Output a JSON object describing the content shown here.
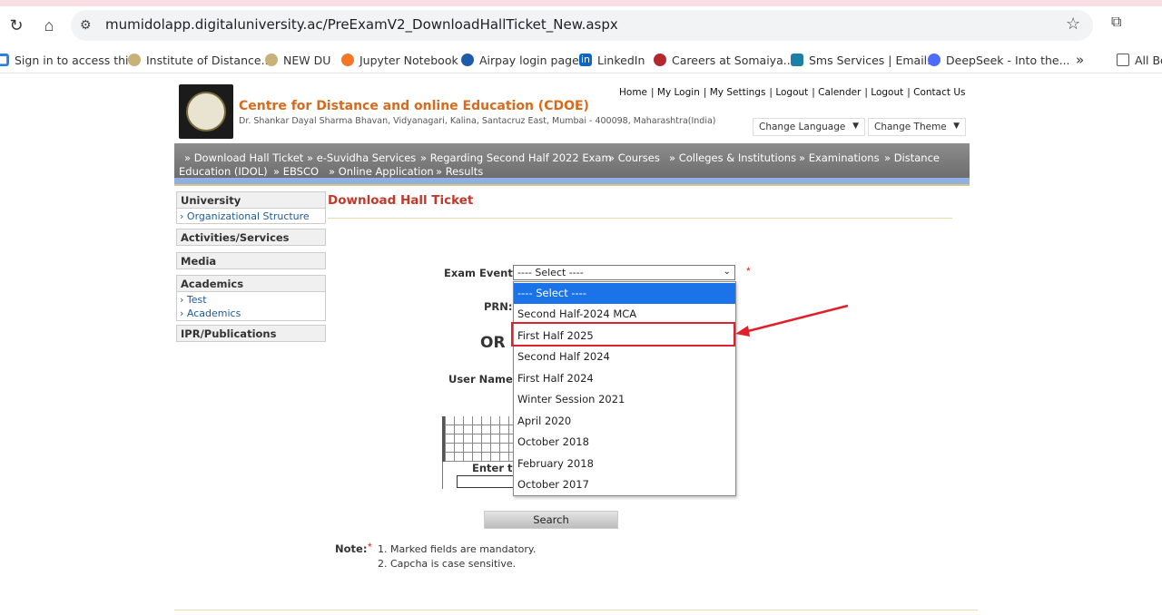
{
  "browser": {
    "url": "mumidolapp.digitaluniversity.ac/PreExamV2_DownloadHallTicket_New.aspx",
    "bookmarks": [
      {
        "label": "Sign in to access thi...",
        "icon": "windows-icon"
      },
      {
        "label": "Institute of Distance...",
        "icon": "globe-icon"
      },
      {
        "label": "NEW DU",
        "icon": "globe-icon"
      },
      {
        "label": "Jupyter Notebook",
        "icon": "jupyter-icon"
      },
      {
        "label": "Airpay login page",
        "icon": "airpay-icon"
      },
      {
        "label": "LinkedIn",
        "icon": "linkedin-icon"
      },
      {
        "label": "Careers at Somaiya...",
        "icon": "somaiya-icon"
      },
      {
        "label": "Sms Services | Email...",
        "icon": "sms-icon"
      },
      {
        "label": "DeepSeek - Into the...",
        "icon": "deepseek-icon"
      },
      {
        "label": "All Bo",
        "icon": "folder-icon"
      }
    ],
    "more": "»"
  },
  "header": {
    "title": "Centre for Distance and online Education (CDOE)",
    "address": "Dr. Shankar Dayal Sharma Bhavan, Vidyanagari, Kalina, Santacruz East, Mumbai - 400098, Maharashtra(India)",
    "links": [
      "Home",
      "My Login",
      "My Settings",
      "Logout",
      "Calender",
      "Logout",
      "Contact Us"
    ],
    "change_language": "Change Language",
    "change_theme": "Change Theme"
  },
  "menu": {
    "line1": [
      "» Download Hall Ticket",
      "» e-Suvidha Services",
      "» Regarding Second Half 2022 Exam",
      "» Courses",
      "» Colleges & Institutions",
      "» Examinations",
      "» Distance"
    ],
    "line2": [
      "Education (IDOL)",
      "» EBSCO",
      "» Online Application",
      "» Results"
    ]
  },
  "sidebar": {
    "university": {
      "title": "University",
      "items": [
        "Organizational Structure"
      ]
    },
    "activities": {
      "title": "Activities/Services"
    },
    "media": {
      "title": "Media"
    },
    "academics": {
      "title": "Academics",
      "items": [
        "Test",
        "Academics"
      ]
    },
    "ipr": {
      "title": "IPR/Publications"
    }
  },
  "main": {
    "title": "Download Hall Ticket",
    "exam_event_label": "Exam Event:",
    "exam_event_value": "---- Select ----",
    "required": "*",
    "prn_label": "PRN:",
    "or_label": "OR",
    "username_label": "User Name:",
    "captcha_label": "Enter th",
    "search_button": "Search",
    "note_label": "Note:",
    "notes": [
      "1. Marked fields are mandatory.",
      "2. Capcha is case sensitive."
    ]
  },
  "dropdown": {
    "options": [
      "---- Select ----",
      "Second Half-2024 MCA",
      "First Half 2025",
      "Second Half 2024",
      "First Half 2024",
      "Winter Session 2021",
      "April 2020",
      "October 2018",
      "February 2018",
      "October 2017"
    ],
    "selected_index": 0,
    "highlighted_index": 2
  },
  "colors": {
    "title_orange": "#d96a1b",
    "page_title_red": "#c0392b",
    "highlight_red": "#e0202a",
    "selected_blue": "#1a73e8"
  }
}
